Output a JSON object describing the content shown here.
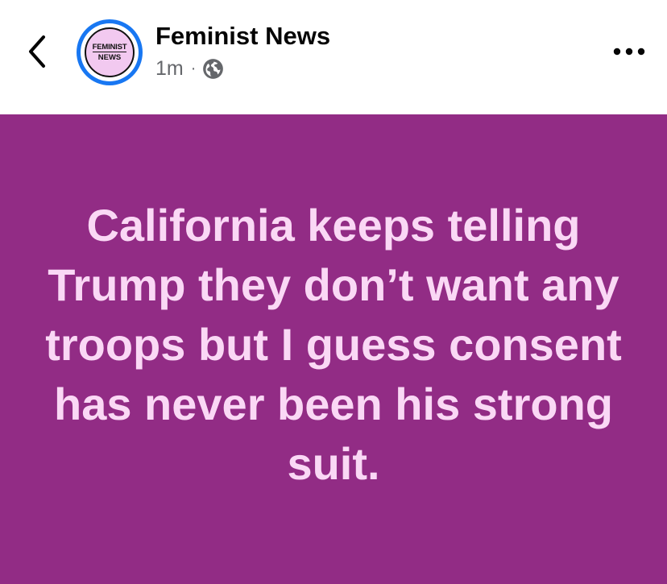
{
  "header": {
    "page_name": "Feminist News",
    "timestamp": "1m",
    "separator": "·",
    "privacy_icon": "globe-icon",
    "back_icon": "chevron-left-icon",
    "more_icon": "more-horizontal-icon"
  },
  "avatar": {
    "line1": "FEMINIST",
    "line2": "NEWS",
    "ring_color": "#1877f2",
    "fill_color": "#f2c9f0"
  },
  "post": {
    "text": "California keeps telling Trump they don’t want any troops but I guess consent has never been his strong suit.",
    "background_color": "#922c85",
    "text_color": "#fad8f5"
  }
}
